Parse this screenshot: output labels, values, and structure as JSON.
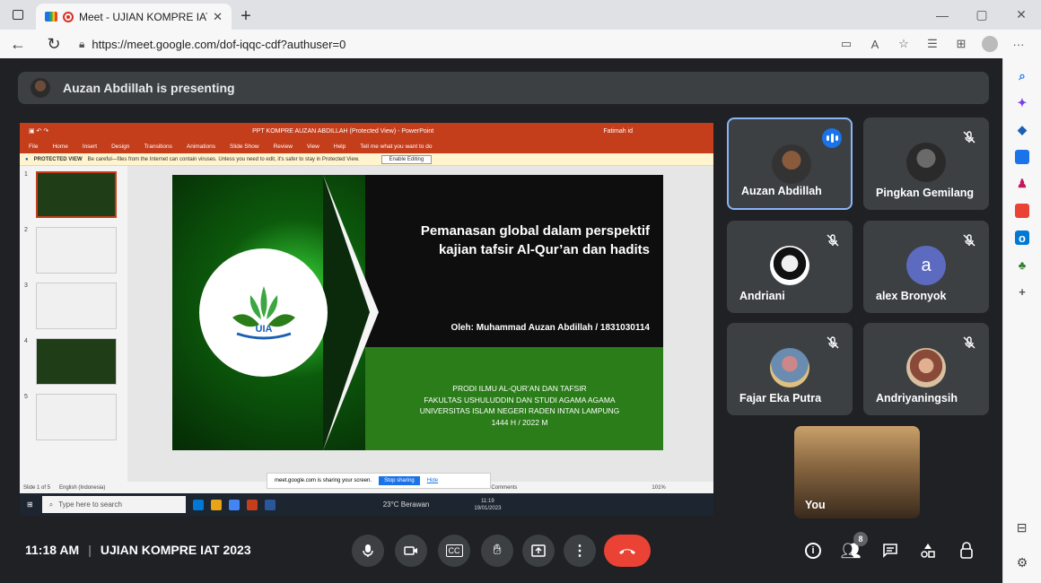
{
  "browser": {
    "tab_title": "Meet - UJIAN KOMPRE IAT",
    "tab_close": "✕",
    "new_tab": "+",
    "url": "https://meet.google.com/dof-iqqc-cdf?authuser=0",
    "window_controls": [
      "—",
      "▢",
      "✕"
    ],
    "more": "···"
  },
  "meet": {
    "presenting_text": "Auzan Abdillah is presenting",
    "time": "11:18 AM",
    "meeting_name": "UJIAN KOMPRE IAT 2023",
    "participants_count": "8",
    "accent": "#8ab4f8",
    "end_call_color": "#ea4335"
  },
  "shared_screen": {
    "ppt_window_title": "PPT KOMPRE AUZAN ABDILLAH (Protected View) - PowerPoint",
    "ppt_user": "Fatimah id",
    "ppt_menu": [
      "File",
      "Home",
      "Insert",
      "Design",
      "Transitions",
      "Animations",
      "Slide Show",
      "Review",
      "View",
      "Help",
      "Tell me what you want to do"
    ],
    "protected_label": "PROTECTED VIEW",
    "protected_msg": "Be careful—files from the Internet can contain viruses. Unless you need to edit, it's safer to stay in Protected View.",
    "enable_editing": "Enable Editing",
    "thumb_numbers": [
      "1",
      "2",
      "3",
      "4",
      "5"
    ],
    "slide": {
      "title": "Pemanasan global dalam perspektif kajian tafsir Al-Qur’an dan hadits",
      "author": "Oleh: Muhammad Auzan Abdillah / 1831030114",
      "prodi": [
        "PRODI ILMU AL-QUR’AN DAN TAFSIR",
        "FAKULTAS USHULUDDIN DAN STUDI AGAMA AGAMA",
        "UNIVERSITAS ISLAM NEGERI RADEN INTAN LAMPUNG",
        "1444 H / 2022 M"
      ],
      "logo_text": "UIA"
    },
    "status_slide": "Slide 1 of 5",
    "status_lang": "English (Indonesia)",
    "status_comments": "Comments",
    "status_zoom": "101%",
    "sharing_msg": "meet.google.com is sharing your screen.",
    "stop_sharing": "Stop sharing",
    "hide": "Hide",
    "taskbar_search": "Type here to search",
    "weather": "23°C Berawan",
    "clock_time": "11:19",
    "clock_date": "19/01/2023"
  },
  "participants": [
    {
      "name": "Auzan Abdillah",
      "speaking": true
    },
    {
      "name": "Pingkan Gemilang",
      "muted": true
    },
    {
      "name": "Andriani",
      "muted": true
    },
    {
      "name": "alex Bronyok",
      "muted": true,
      "initial": "a"
    },
    {
      "name": "Fajar Eka Putra",
      "muted": true
    },
    {
      "name": "Andriyaningsih",
      "muted": true
    }
  ],
  "self": {
    "name": "You"
  }
}
